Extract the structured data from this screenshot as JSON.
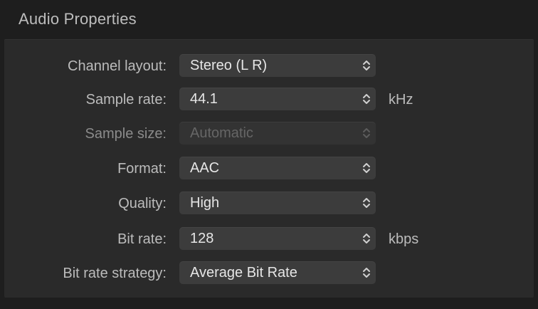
{
  "section": {
    "title": "Audio Properties"
  },
  "rows": [
    {
      "label": "Channel layout:",
      "value": "Stereo (L R)",
      "unit": "",
      "disabled": false
    },
    {
      "label": "Sample rate:",
      "value": "44.1",
      "unit": "kHz",
      "disabled": false
    },
    {
      "label": "Sample size:",
      "value": "Automatic",
      "unit": "",
      "disabled": true
    },
    {
      "label": "Format:",
      "value": "AAC",
      "unit": "",
      "disabled": false
    },
    {
      "label": "Quality:",
      "value": "High",
      "unit": "",
      "disabled": false
    },
    {
      "label": "Bit rate:",
      "value": "128",
      "unit": "kbps",
      "disabled": false
    },
    {
      "label": "Bit rate strategy:",
      "value": "Average Bit Rate",
      "unit": "",
      "disabled": false
    }
  ],
  "icons": {
    "popup": "chevron-up-down-icon"
  },
  "colors": {
    "background": "#1e1e1e",
    "panel": "#2a2a2a",
    "control": "#3c3c3c",
    "label": "#bcbcbc",
    "value": "#e6e6e6",
    "disabled_text": "#666666"
  }
}
